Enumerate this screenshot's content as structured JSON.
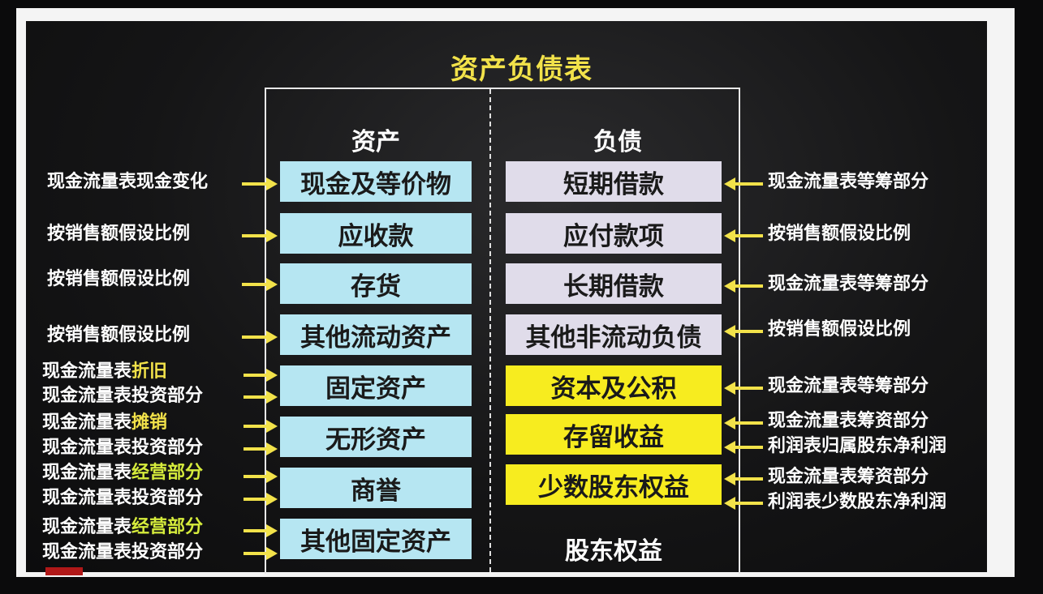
{
  "title": "资产负债表",
  "columns": {
    "assets": "资产",
    "liabilities": "负债",
    "equity": "股东权益"
  },
  "assets": [
    {
      "name": "现金及等价物",
      "sources": [
        {
          "main": "现金流量表现金变化",
          "highlight": ""
        }
      ]
    },
    {
      "name": "应收款",
      "sources": [
        {
          "main": "按销售额假设比例",
          "highlight": ""
        }
      ]
    },
    {
      "name": "存货",
      "sources": [
        {
          "main": "按销售额假设比例",
          "highlight": ""
        }
      ]
    },
    {
      "name": "其他流动资产",
      "sources": [
        {
          "main": "按销售额假设比例",
          "highlight": ""
        }
      ]
    },
    {
      "name": "固定资产",
      "sources": [
        {
          "main": "现金流量表",
          "highlight": "折旧"
        },
        {
          "main": "现金流量表投资部分",
          "highlight": ""
        }
      ]
    },
    {
      "name": "无形资产",
      "sources": [
        {
          "main": "现金流量表",
          "highlight": "摊销"
        },
        {
          "main": "现金流量表投资部分",
          "highlight": ""
        }
      ]
    },
    {
      "name": "商誉",
      "sources": [
        {
          "main": "现金流量表",
          "highlight": "经营部分"
        },
        {
          "main": "现金流量表投资部分",
          "highlight": ""
        }
      ]
    },
    {
      "name": "其他固定资产",
      "sources": [
        {
          "main": "现金流量表",
          "highlight": "经营部分"
        },
        {
          "main": "现金流量表投资部分",
          "highlight": ""
        }
      ]
    }
  ],
  "liabilities": [
    {
      "name": "短期借款",
      "sources": [
        "现金流量表等筹部分"
      ]
    },
    {
      "name": "应付款项",
      "sources": [
        "按销售额假设比例"
      ]
    },
    {
      "name": "长期借款",
      "sources": [
        "现金流量表等筹部分"
      ]
    },
    {
      "name": "其他非流动负债",
      "sources": [
        "按销售额假设比例"
      ]
    }
  ],
  "equity_items": [
    {
      "name": "资本及公积",
      "sources": [
        "现金流量表等筹部分"
      ]
    },
    {
      "name": "存留收益",
      "sources": [
        "现金流量表筹资部分",
        "利润表归属股东净利润"
      ]
    },
    {
      "name": "少数股东权益",
      "sources": [
        "现金流量表筹资部分",
        "利润表少数股东净利润"
      ]
    }
  ],
  "colors": {
    "asset_box": "#b6e6f2",
    "liability_box": "#e0dcea",
    "equity_box": "#f7ec1f",
    "arrow": "#f2e24a",
    "title": "#f2e24a"
  }
}
